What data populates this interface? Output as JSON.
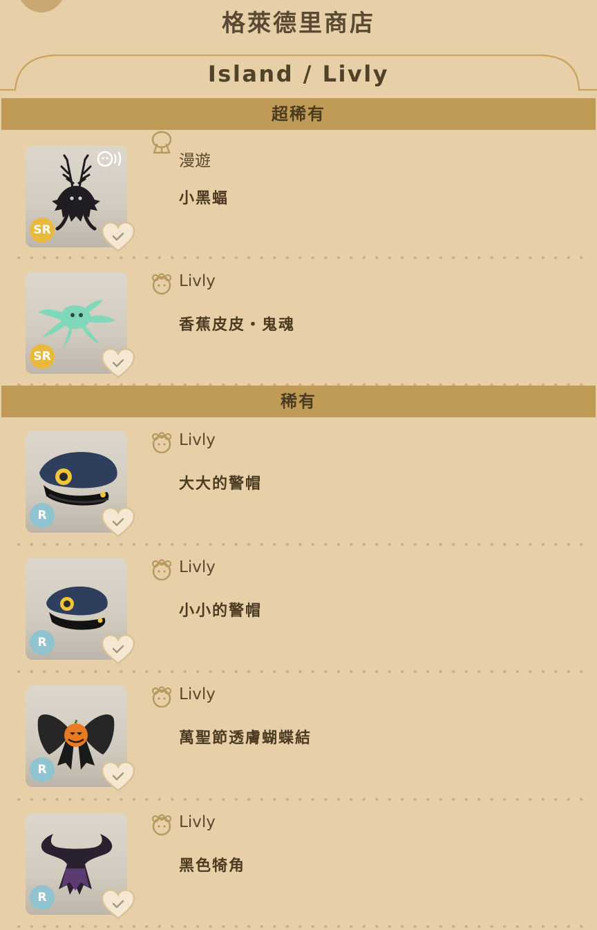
{
  "header": {
    "shop_title": "格萊德里商店",
    "tab_title": "Island / Livly"
  },
  "sections": [
    {
      "title": "超稀有",
      "items": [
        {
          "source_icon": "balloon-icon",
          "source": "漫遊",
          "name": "小黑蝠",
          "rarity": "SR",
          "thumb": "antlered-bat-creature",
          "badge_icon": "sound-icon"
        },
        {
          "source_icon": "livly-face-icon",
          "source": "Livly",
          "name": "香蕉皮皮・鬼魂",
          "rarity": "SR",
          "thumb": "green-ghost-starfish"
        }
      ]
    },
    {
      "title": "稀有",
      "items": [
        {
          "source_icon": "livly-face-icon",
          "source": "Livly",
          "name": "大大的警帽",
          "rarity": "R",
          "thumb": "big-police-cap"
        },
        {
          "source_icon": "livly-face-icon",
          "source": "Livly",
          "name": "小小的警帽",
          "rarity": "R",
          "thumb": "small-police-cap"
        },
        {
          "source_icon": "livly-face-icon",
          "source": "Livly",
          "name": "萬聖節透膚蝴蝶結",
          "rarity": "R",
          "thumb": "halloween-bow"
        },
        {
          "source_icon": "livly-face-icon",
          "source": "Livly",
          "name": "黑色犄角",
          "rarity": "R",
          "thumb": "black-horns"
        }
      ]
    }
  ],
  "colors": {
    "background": "#e7cfa8",
    "section_bar": "#c09b55",
    "sr_badge": "#e9b93b",
    "r_badge": "#8fc3cf"
  }
}
